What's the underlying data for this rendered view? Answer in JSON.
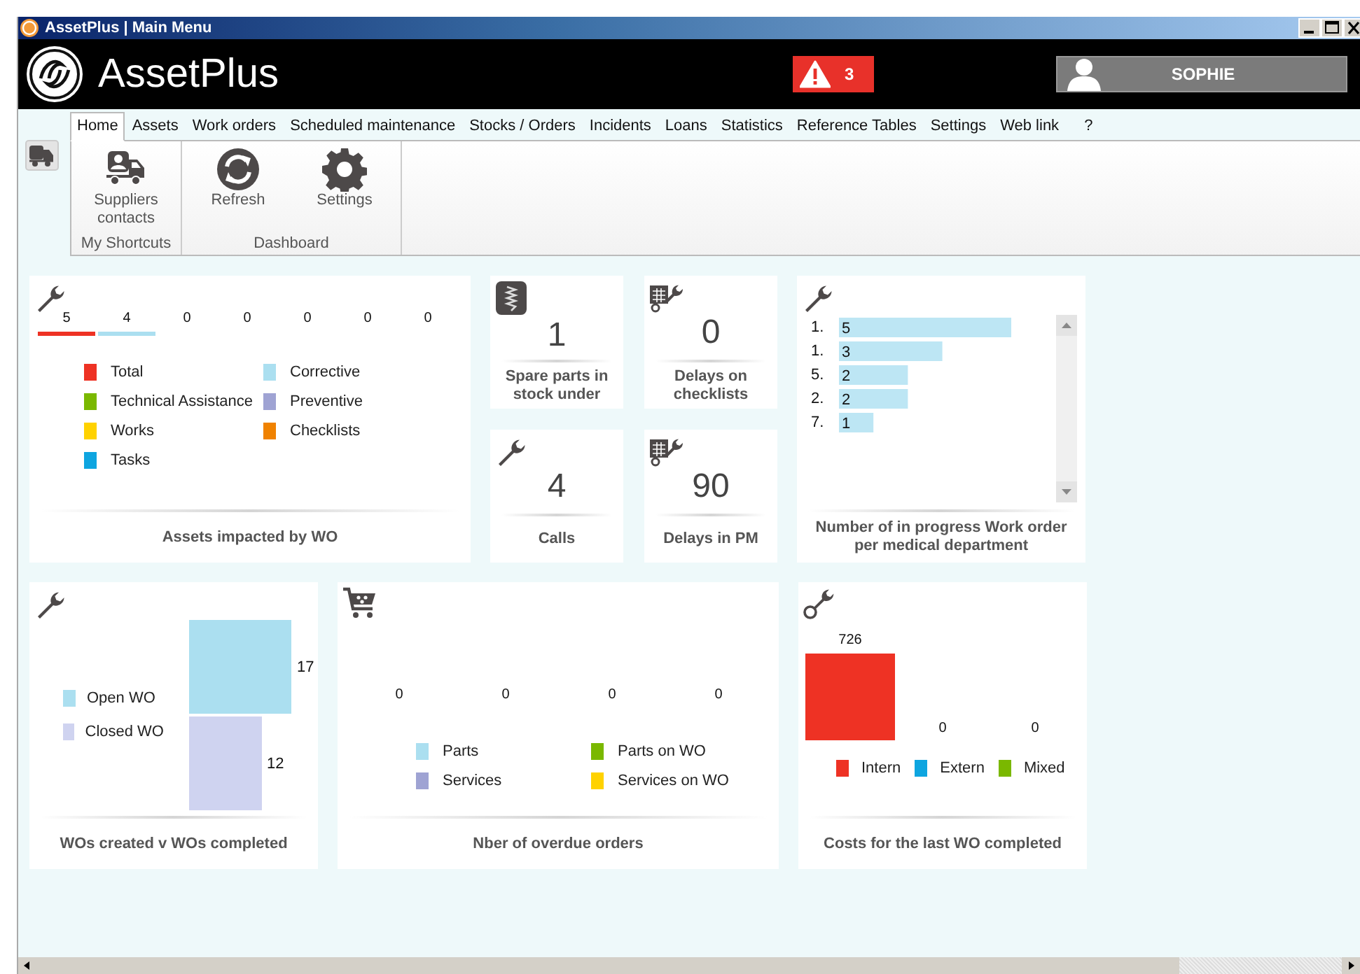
{
  "window": {
    "title": "AssetPlus | Main Menu"
  },
  "header": {
    "app_name": "AssetPlus",
    "alert_count": "3",
    "user": "SOPHIE"
  },
  "tabs": [
    {
      "label": "Home",
      "selected": true
    },
    {
      "label": "Assets",
      "selected": false
    },
    {
      "label": "Work orders",
      "selected": false
    },
    {
      "label": "Scheduled maintenance",
      "selected": false
    },
    {
      "label": "Stocks / Orders",
      "selected": false
    },
    {
      "label": "Incidents",
      "selected": false
    },
    {
      "label": "Loans",
      "selected": false
    },
    {
      "label": "Statistics",
      "selected": false
    },
    {
      "label": "Reference Tables",
      "selected": false
    },
    {
      "label": "Settings",
      "selected": false
    },
    {
      "label": "Web link",
      "selected": false
    },
    {
      "label": "?",
      "selected": false
    }
  ],
  "ribbon": {
    "groups": [
      {
        "label": "My Shortcuts",
        "buttons": [
          {
            "kind": "suppliers",
            "label": "Suppliers contacts"
          }
        ]
      },
      {
        "label": "Dashboard",
        "buttons": [
          {
            "kind": "refresh",
            "label": "Refresh"
          },
          {
            "kind": "settings",
            "label": "Settings"
          }
        ]
      }
    ]
  },
  "dashboard": {
    "assets_widget": {
      "title": "Assets impacted by WO",
      "counts": [
        {
          "value": "5",
          "color": "#ee3224"
        },
        {
          "value": "4",
          "color": "#abdff0"
        },
        {
          "value": "0"
        },
        {
          "value": "0"
        },
        {
          "value": "0"
        },
        {
          "value": "0"
        },
        {
          "value": "0"
        }
      ],
      "legend": [
        {
          "label": "Total",
          "color": "#ee3224"
        },
        {
          "label": "Corrective",
          "color": "#abdff0"
        },
        {
          "label": "Technical Assistance",
          "color": "#7ab800"
        },
        {
          "label": "Preventive",
          "color": "#9fa3d3"
        },
        {
          "label": "Works",
          "color": "#ffd200"
        },
        {
          "label": "Checklists",
          "color": "#f08200"
        },
        {
          "label": "Tasks",
          "color": "#0ea5e0"
        }
      ]
    },
    "tiles": [
      {
        "kind": "stock",
        "value": "1",
        "label": "Spare parts in stock under"
      },
      {
        "kind": "checklist-delay",
        "value": "0",
        "label": "Delays on checklists"
      },
      {
        "kind": "calls",
        "value": "4",
        "label": "Calls"
      },
      {
        "kind": "pm-delay",
        "value": "90",
        "label": "Delays in PM"
      }
    ],
    "department_widget": {
      "title": "Number of in progress Work order per medical department",
      "chart_data": {
        "type": "bar",
        "orientation": "horizontal",
        "data_labels": true,
        "categories": [
          "1.",
          "1.",
          "5.",
          "2.",
          "7."
        ],
        "series": [
          {
            "color": "#bde6f4",
            "values": [
              5,
              3,
              2,
              2,
              1
            ]
          }
        ]
      }
    },
    "wo_widget": {
      "title": "WOs created v WOs completed",
      "bars": [
        {
          "label": "Open WO",
          "color": "#abdff0",
          "value": "17"
        },
        {
          "label": "Closed WO",
          "color": "#cfd3f0",
          "value": "12"
        }
      ]
    },
    "orders_widget": {
      "title": "Nber of overdue orders",
      "counts": [
        "0",
        "0",
        "0",
        "0"
      ],
      "legend": [
        {
          "label": "Parts",
          "color": "#abdff0"
        },
        {
          "label": "Parts on WO",
          "color": "#7ab800"
        },
        {
          "label": "Services",
          "color": "#9fa3d3"
        },
        {
          "label": "Services on WO",
          "color": "#ffd200"
        }
      ]
    },
    "costs_widget": {
      "title": "Costs for the last WO completed",
      "bars": [
        {
          "label": "Intern",
          "color": "#ee3224",
          "value": "726"
        },
        {
          "label": "Extern",
          "color": "#0ea5e0",
          "value": "0"
        },
        {
          "label": "Mixed",
          "color": "#7ab800",
          "value": "0"
        }
      ]
    }
  }
}
